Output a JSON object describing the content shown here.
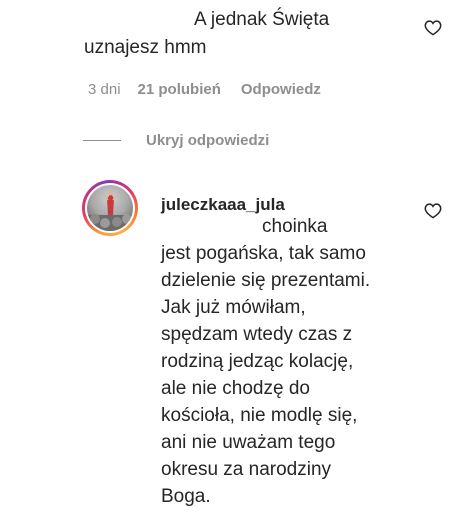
{
  "comment": {
    "text_line1": "A jednak Święta",
    "text_line2": "uznajesz hmm",
    "time": "3 dni",
    "likes": "21 polubień",
    "reply_label": "Odpowiedz"
  },
  "replies_toggle": {
    "label": "Ukryj odpowiedzi"
  },
  "reply": {
    "username": "juleczkaaa_jula",
    "lines": [
      "choinka",
      "jest pogańska, tak samo",
      "dzielenie się prezentami.",
      "Jak już mówiłam,",
      "spędzam wtedy czas z",
      "rodziną jedząc kolację,",
      "ale nie chodzę do",
      "kościoła, nie modlę się,",
      "ani nie uważam tego",
      "okresu za narodziny",
      "Boga."
    ]
  },
  "icons": {
    "like": "heart-outline-icon",
    "avatar": "user-avatar"
  },
  "colors": {
    "text": "#262626",
    "secondary": "#8e8e8e"
  }
}
